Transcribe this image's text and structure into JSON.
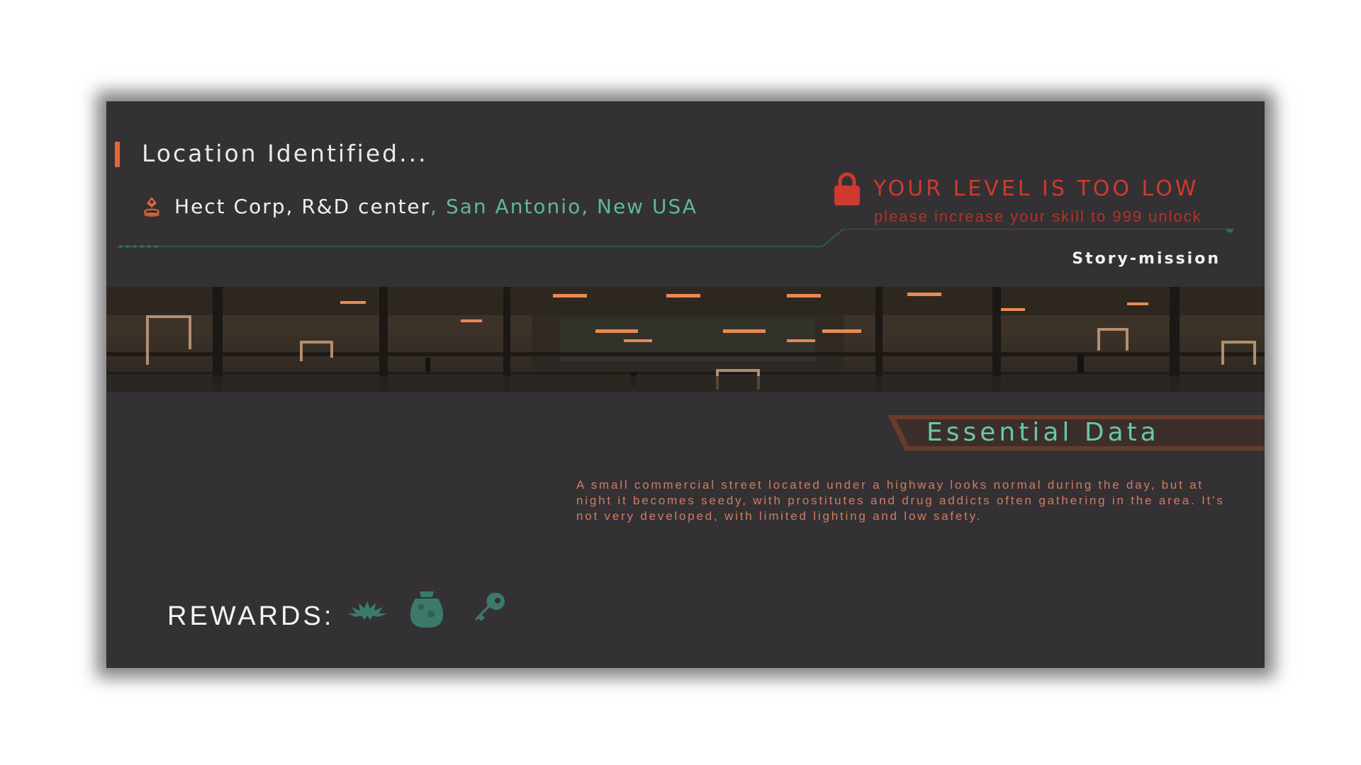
{
  "header": {
    "title": "Location Identified..."
  },
  "location": {
    "name": "Hect Corp, R&D center",
    "city": ", San Antonio, New USA",
    "icon": "location-pin-icon"
  },
  "lock_notice": {
    "title": "YOUR LEVEL IS TOO LOW",
    "subtitle": "please increase your skill to 999 unlock",
    "icon": "lock-icon"
  },
  "mission_type": "Story-mission",
  "essential": {
    "heading": "Essential Data",
    "description": "A small commercial street located under a highway looks normal during the day, but at night it becomes seedy, with prostitutes and drug addicts often gathering in the area. It's not very developed, with limited lighting and low safety."
  },
  "rewards": {
    "label": "REWARDS:",
    "items": [
      "cannabis-leaf-icon",
      "loot-bag-icon",
      "key-icon"
    ]
  },
  "colors": {
    "panel": "#333134",
    "accent_orange": "#e0673a",
    "accent_teal": "#5fb89a",
    "warning_red": "#cf3a2f",
    "description_text": "#cf7d60"
  }
}
